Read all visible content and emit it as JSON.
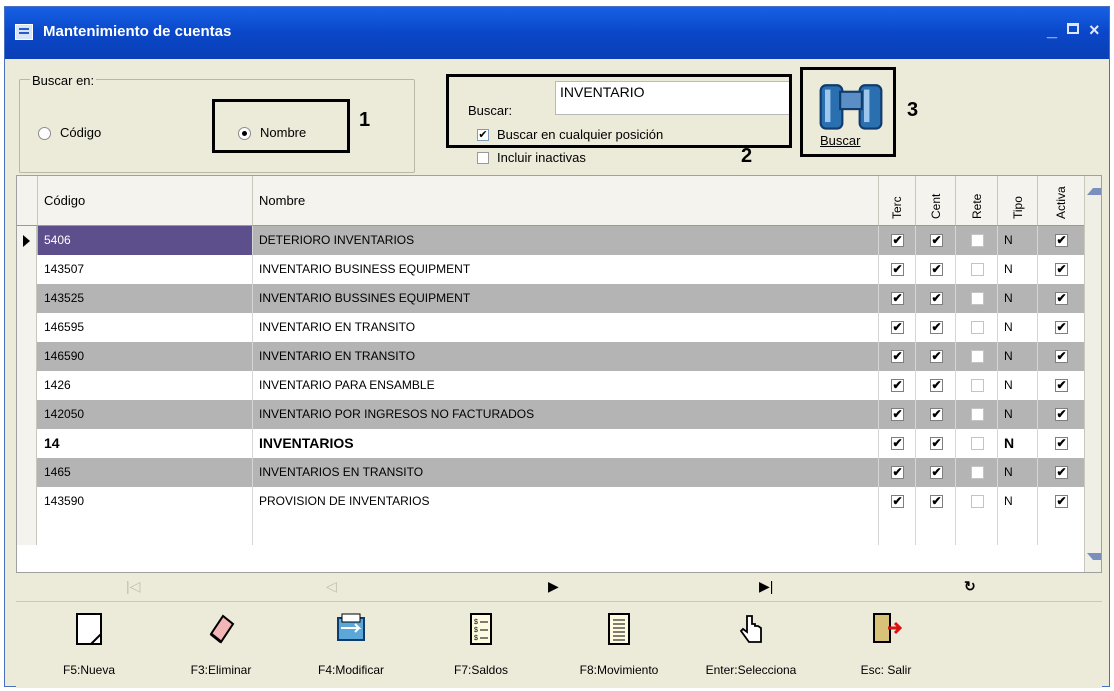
{
  "window": {
    "title": "Mantenimiento de cuentas"
  },
  "search": {
    "group_label": "Buscar en:",
    "radio_codigo": "Código",
    "radio_nombre": "Nombre",
    "buscar_label": "Buscar:",
    "buscar_value": "INVENTARIO",
    "check_cualquier": "Buscar en cualquier posición",
    "check_inactivas": "Incluir inactivas",
    "button_label": "Buscar"
  },
  "annotations": {
    "a1": "1",
    "a2": "2",
    "a3": "3"
  },
  "table": {
    "headers": {
      "codigo": "Código",
      "nombre": "Nombre",
      "terc": "Terc",
      "cent": "Cent",
      "rete": "Rete",
      "tipo": "Tipo",
      "activa": "Activa"
    },
    "rows": [
      {
        "codigo": "5406",
        "nombre": "DETERIORO INVENTARIOS",
        "tipo": "N"
      },
      {
        "codigo": "143507",
        "nombre": "INVENTARIO BUSINESS EQUIPMENT",
        "tipo": "N"
      },
      {
        "codigo": "143525",
        "nombre": "INVENTARIO BUSSINES EQUIPMENT",
        "tipo": "N"
      },
      {
        "codigo": "146595",
        "nombre": "INVENTARIO EN TRANSITO",
        "tipo": "N"
      },
      {
        "codigo": "146590",
        "nombre": "INVENTARIO EN TRANSITO",
        "tipo": "N"
      },
      {
        "codigo": "1426",
        "nombre": "INVENTARIO PARA ENSAMBLE",
        "tipo": "N"
      },
      {
        "codigo": "142050",
        "nombre": "INVENTARIO POR INGRESOS NO FACTURADOS",
        "tipo": "N"
      },
      {
        "codigo": "14",
        "nombre": "INVENTARIOS",
        "tipo": "N"
      },
      {
        "codigo": "1465",
        "nombre": "INVENTARIOS EN TRANSITO",
        "tipo": "N"
      },
      {
        "codigo": "143590",
        "nombre": "PROVISION DE INVENTARIOS",
        "tipo": "N"
      }
    ]
  },
  "toolbar": {
    "nueva": "F5:Nueva",
    "eliminar": "F3:Eliminar",
    "modificar": "F4:Modificar",
    "saldos": "F7:Saldos",
    "movimiento": "F8:Movimiento",
    "selecciona": "Enter:Selecciona",
    "salir": "Esc: Salir"
  }
}
